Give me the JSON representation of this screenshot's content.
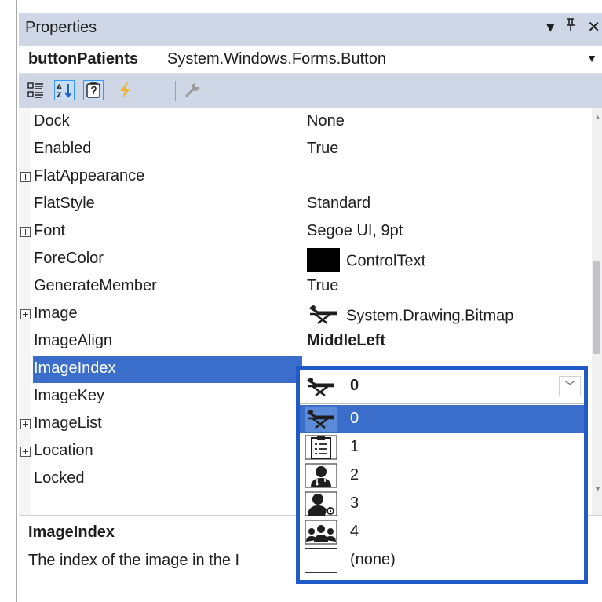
{
  "titlebar": {
    "title": "Properties",
    "dropdown_icon": "▾",
    "pin_icon": "⊥",
    "close_icon": "✕"
  },
  "object": {
    "name": "buttonPatients",
    "type": "System.Windows.Forms.Button"
  },
  "toolbar": {
    "buttons": [
      "categorized-icon",
      "alphabetical-icon",
      "properties-icon",
      "events-icon",
      "property-pages-icon"
    ]
  },
  "properties": [
    {
      "name": "Dock",
      "value": "None"
    },
    {
      "name": "Enabled",
      "value": "True"
    },
    {
      "name": "FlatAppearance",
      "value": ""
    },
    {
      "name": "FlatStyle",
      "value": "Standard"
    },
    {
      "name": "Font",
      "value": "Segoe UI, 9pt"
    },
    {
      "name": "ForeColor",
      "value": "ControlText"
    },
    {
      "name": "GenerateMember",
      "value": "True"
    },
    {
      "name": "Image",
      "value": "System.Drawing.Bitmap"
    },
    {
      "name": "ImageAlign",
      "value": "MiddleLeft"
    },
    {
      "name": "ImageIndex",
      "value": ""
    },
    {
      "name": "ImageKey",
      "value": ""
    },
    {
      "name": "ImageList",
      "value": ""
    },
    {
      "name": "Location",
      "value": ""
    },
    {
      "name": "Locked",
      "value": ""
    }
  ],
  "description": {
    "title": "ImageIndex",
    "text": "The index of the image in the I"
  },
  "dropdown": {
    "current": "0",
    "options": [
      "0",
      "1",
      "2",
      "3",
      "4",
      "(none)"
    ]
  },
  "colors": {
    "accent": "#3b6ecb",
    "dropdown_border": "#1f5ac8",
    "titlebar_bg": "#cfd6e5"
  }
}
